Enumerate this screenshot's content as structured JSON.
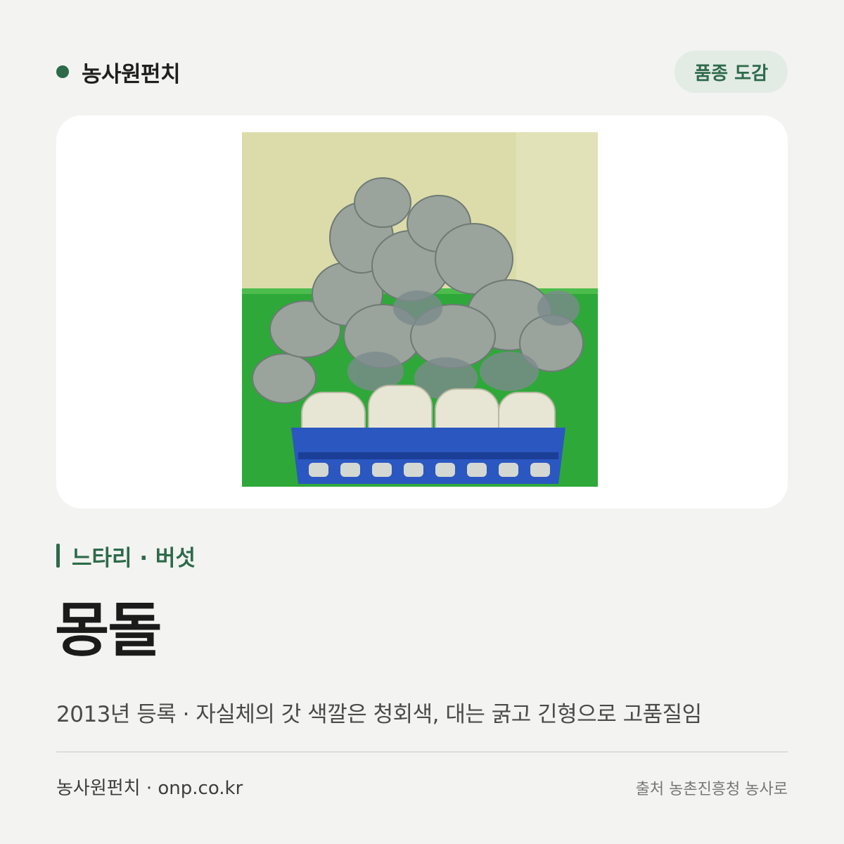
{
  "header": {
    "brand_name": "농사원펀치",
    "chip_label": "품종 도감"
  },
  "variety": {
    "category": "느타리 · 버섯",
    "name": "몽돌",
    "description": "2013년 등록 · 자실체의 갓 색깔은 청회색, 대는 굵고 긴형으로 고품질임"
  },
  "footer": {
    "left": "농사원펀치 · onp.co.kr",
    "right": "출처 농촌진흥청 농사로"
  },
  "colors": {
    "accent": "#2d6a4a",
    "chip_bg": "#e3ebe5",
    "page_bg": "#f3f3f1"
  }
}
